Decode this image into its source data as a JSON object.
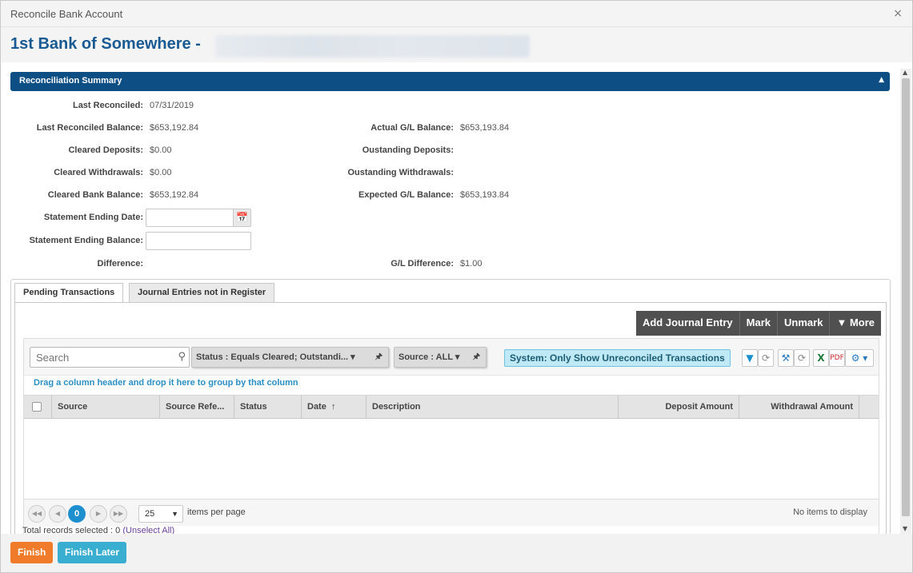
{
  "window": {
    "title": "Reconcile Bank Account",
    "close_icon": "×",
    "bank_name": "1st Bank of Somewhere -"
  },
  "summary": {
    "header": "Reconciliation Summary",
    "collapse_icon": "▲",
    "last_reconciled_label": "Last Reconciled:",
    "last_reconciled": "07/31/2019",
    "last_reconciled_balance_label": "Last Reconciled Balance:",
    "last_reconciled_balance": "$653,192.84",
    "cleared_deposits_label": "Cleared Deposits:",
    "cleared_deposits": "$0.00",
    "cleared_withdrawals_label": "Cleared Withdrawals:",
    "cleared_withdrawals": "$0.00",
    "cleared_bank_balance_label": "Cleared Bank Balance:",
    "cleared_bank_balance": "$653,192.84",
    "statement_ending_date_label": "Statement Ending Date:",
    "statement_ending_date": "",
    "statement_ending_balance_label": "Statement Ending Balance:",
    "statement_ending_balance": "",
    "difference_label": "Difference:",
    "actual_gl_balance_label": "Actual G/L Balance:",
    "actual_gl_balance": "$653,193.84",
    "outstanding_deposits_label": "Oustanding Deposits:",
    "outstanding_withdrawals_label": "Oustanding Withdrawals:",
    "expected_gl_balance_label": "Expected G/L Balance:",
    "expected_gl_balance": "$653,193.84",
    "gl_difference_label": "G/L Difference:",
    "gl_difference": "$1.00"
  },
  "tabs": [
    {
      "label": "Pending Transactions",
      "active": true
    },
    {
      "label": "Journal Entries not in Register",
      "active": false
    }
  ],
  "actions": {
    "add_journal_entry": "Add Journal Entry",
    "mark": "Mark",
    "unmark": "Unmark",
    "more": "More",
    "more_icon": "▼"
  },
  "grid": {
    "search_placeholder": "Search",
    "status_filter": "Status : Equals Cleared; Outstandi... ▾",
    "source_filter": "Source : ALL ▾",
    "system_filter": "System: Only Show Unreconciled Transactions",
    "group_hint": "Drag a column header and drop it here to group by that column",
    "columns": [
      "Source",
      "Source Refe...",
      "Status",
      "Date",
      "Description",
      "Deposit Amount",
      "Withdrawal Amount"
    ],
    "sort_icon": "↑",
    "page_current": "0",
    "page_size": "25",
    "items_per_page": "items per page",
    "no_items": "No items to display",
    "total_selected": "Total records selected : 0",
    "unselect_all": "(Unselect All)"
  },
  "footer": {
    "finish": "Finish",
    "finish_later": "Finish Later"
  },
  "colors": {
    "header_blue": "#0d4e85",
    "bank_title": "#1a5a92",
    "finish_orange": "#f07b2a",
    "finish_later_blue": "#3aaed0",
    "system_chip": "#bfe9f5"
  }
}
